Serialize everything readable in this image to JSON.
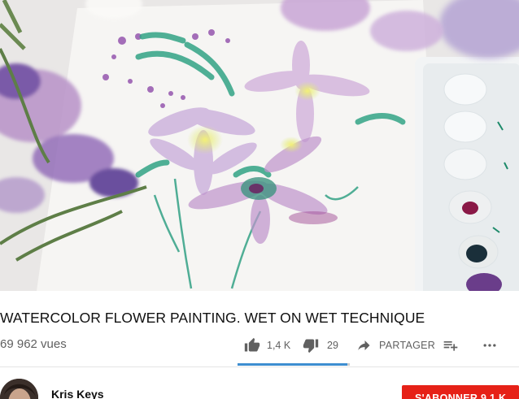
{
  "video": {
    "title": "WATERCOLOR FLOWER PAINTING. WET ON WET TECHNIQUE",
    "views": "69 962 vues",
    "colors": {
      "accent_blue": "#3e8ed0",
      "subscribe_red": "#e62117",
      "meta_gray": "#606060"
    }
  },
  "actions": {
    "like_icon": "thumbs-up-icon",
    "like_count": "1,4 K",
    "dislike_icon": "thumbs-down-icon",
    "dislike_count": "29",
    "share_icon": "share-arrow-icon",
    "share_label": "PARTAGER",
    "add_icon": "add-to-playlist-icon",
    "more_icon": "more-horizontal-icon",
    "like_ratio": 0.98
  },
  "channel": {
    "name": "Kris Keys",
    "subscribe_label": "S'ABONNER 9,1 K"
  }
}
